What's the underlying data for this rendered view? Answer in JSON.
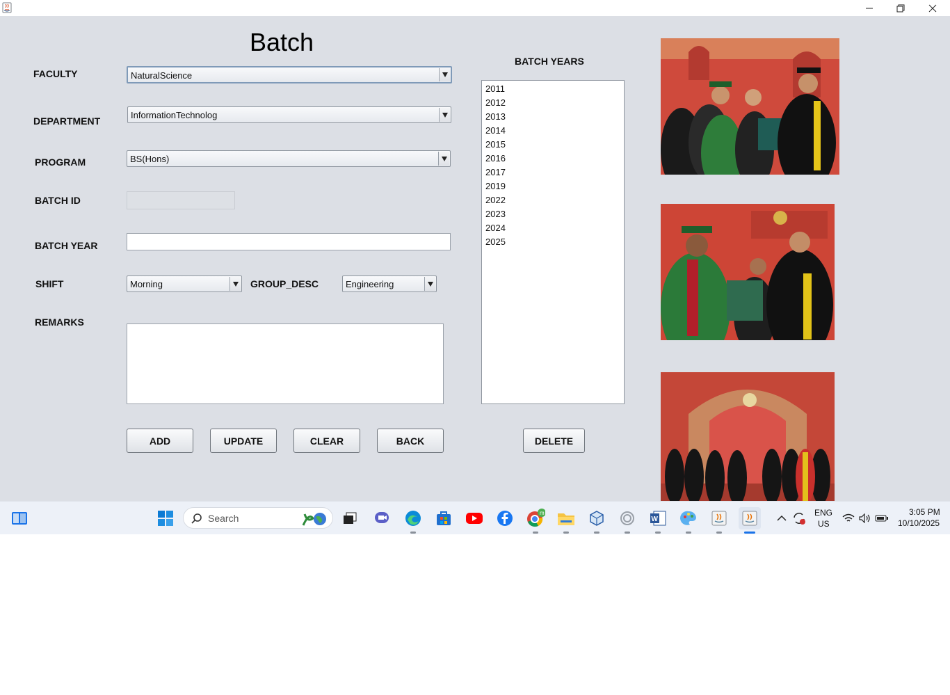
{
  "window": {
    "controls": {
      "minimize": "minimize",
      "restore": "restore",
      "close": "close"
    }
  },
  "form": {
    "title": "Batch",
    "labels": {
      "faculty": "FACULTY",
      "department": "DEPARTMENT",
      "program": "PROGRAM",
      "batch_id": "BATCH ID",
      "batch_year": "BATCH YEAR",
      "shift": "SHIFT",
      "group_desc": "GROUP_DESC",
      "remarks": "REMARKS"
    },
    "faculty_value": "NaturalScience",
    "department_value": "InformationTechnolog",
    "program_value": "BS(Hons)",
    "batch_id_value": "",
    "batch_year_value": "",
    "shift_value": "Morning",
    "group_desc_value": "Engineering",
    "remarks_value": ""
  },
  "buttons": {
    "add": "ADD",
    "update": "UPDATE",
    "clear": "CLEAR",
    "back": "BACK",
    "delete": "DELETE"
  },
  "batch_years": {
    "header": "BATCH YEARS",
    "items": [
      "2011",
      "2012",
      "2013",
      "2014",
      "2015",
      "2016",
      "2017",
      "2019",
      "2022",
      "2023",
      "2024",
      "2025"
    ]
  },
  "taskbar": {
    "search_placeholder": "Search",
    "language": "ENG",
    "region": "US",
    "time": "3:05 PM",
    "date": "10/10/2025"
  },
  "colors": {
    "window_bg": "#dcdfe5",
    "taskbar_bg": "#edf1f8",
    "accent": "#1a73e8"
  }
}
